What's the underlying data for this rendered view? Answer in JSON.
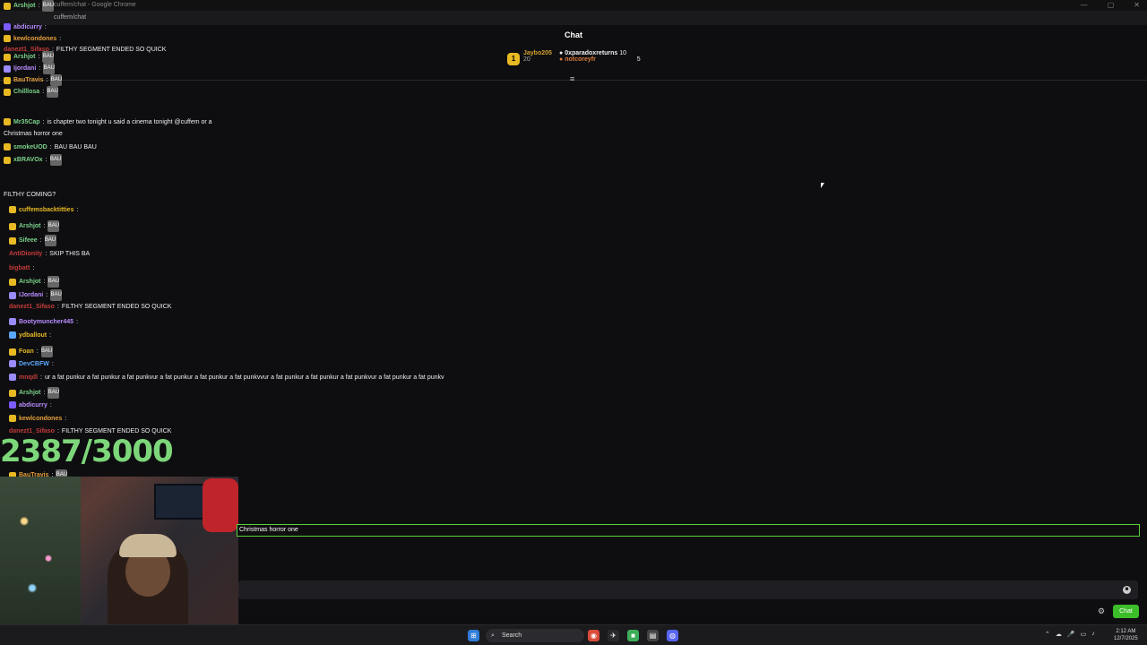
{
  "window": {
    "title": "cuffem/chat - Google Chrome",
    "url": "cuffem/chat"
  },
  "header": {
    "title": "Chat",
    "leaderboard": [
      {
        "rank": "1",
        "name": "Jaybo205",
        "count": "20",
        "color": "#d4a12c"
      },
      {
        "rank": "",
        "name": "0xparadoxreturns",
        "count": "10",
        "color": "#ffffff"
      },
      {
        "rank": "",
        "name": "notcoreyfr",
        "count": "5",
        "color": "#d97b3a"
      }
    ]
  },
  "messages": [
    {
      "user": "Arshjot",
      "text": "",
      "emote": "BAU",
      "color": "#7bd389",
      "badge": "#e8b923"
    },
    {
      "user": "abdicurry",
      "text": "",
      "emote": "",
      "color": "#b98cff",
      "badge": "#7c5cff"
    },
    {
      "user": "kewlcondones",
      "text": "",
      "emote": "",
      "color": "#e59e3a",
      "badge": "#e8b923"
    },
    {
      "user": "danezt1_Sifaso",
      "text": "FILTHY SEGMENT ENDED SO QUICK",
      "emote": "",
      "color": "#c43b3b",
      "badge": ""
    },
    {
      "user": "Arshjot",
      "text": "",
      "emote": "BAU",
      "color": "#7bd389",
      "badge": "#e8b923"
    },
    {
      "user": "Ijordani",
      "text": "",
      "emote": "BAU",
      "color": "#b98cff",
      "badge": "#9b8cff"
    },
    {
      "user": "BauTravis",
      "text": "",
      "emote": "BAU",
      "color": "#e59e3a",
      "badge": "#e8b923"
    },
    {
      "user": "Chilllosa",
      "text": "",
      "emote": "BAU",
      "color": "#7bd389",
      "badge": "#e8b923"
    },
    {
      "user": "Mr35Cap",
      "text": "is chapter two tonight u said a cinema tonight @cuffem or a",
      "emote": "",
      "color": "#7bd389",
      "badge": "#e8b923"
    },
    {
      "user": "",
      "text": "Christmas horror one",
      "emote": "",
      "color": "#ffffff",
      "badge": ""
    },
    {
      "user": "smokeUOD",
      "text": "BAU BAU BAU",
      "emote": "",
      "color": "#7bd389",
      "badge": "#e8b923"
    },
    {
      "user": "xBRAVOx",
      "text": "",
      "emote": "BAU",
      "color": "#7bd389",
      "badge": "#e8b923"
    },
    {
      "user": "",
      "text": "FILTHY COMING?",
      "emote": "",
      "color": "#ffffff",
      "badge": ""
    },
    {
      "user": "cuffemsbacktitties",
      "text": "",
      "emote": "",
      "color": "#e8b923",
      "badge": "#e8b923"
    },
    {
      "user": "Arshjot",
      "text": "",
      "emote": "BAU",
      "color": "#7bd389",
      "badge": "#e8b923"
    },
    {
      "user": "Sifeee",
      "text": "",
      "emote": "BAU",
      "color": "#7bd389",
      "badge": "#e8b923"
    },
    {
      "user": "AntiDionity",
      "text": "SKIP THIS BA",
      "emote": "",
      "color": "#c43b3b",
      "badge": ""
    },
    {
      "user": "bigbatt",
      "text": "",
      "emote": "",
      "color": "#c43b3b",
      "badge": ""
    },
    {
      "user": "Arshjot",
      "text": "",
      "emote": "BAU",
      "color": "#7bd389",
      "badge": "#e8b923"
    },
    {
      "user": "IJordani",
      "text": "",
      "emote": "BAU",
      "color": "#b98cff",
      "badge": "#9b8cff"
    },
    {
      "user": "danezt1_Sifaso",
      "text": "FILTHY SEGMENT ENDED SO QUICK",
      "emote": "",
      "color": "#c43b3b",
      "badge": ""
    },
    {
      "user": "Bootymuncher445",
      "text": "",
      "emote": "",
      "color": "#b98cff",
      "badge": "#9b8cff"
    },
    {
      "user": "ydballout",
      "text": "",
      "emote": "",
      "color": "#e8b923",
      "badge": "#5aa8ff"
    },
    {
      "user": "Foan",
      "text": "",
      "emote": "BAU",
      "color": "#e8b923",
      "badge": "#e8b923"
    },
    {
      "user": "DevCBFW",
      "text": "",
      "emote": "",
      "color": "#5aa8ff",
      "badge": "#9b8cff"
    },
    {
      "user": "mnqdl",
      "text": "ur a fat punkur a fat punkur a fat punkvur a fat punkur a fat punkur a fat punkvvur a fat punkur a fat punkur a fat punkvur a fat punkur a fat punkv",
      "emote": "",
      "color": "#c43b3b",
      "badge": "#9b8cff"
    },
    {
      "user": "Arshjot",
      "text": "",
      "emote": "BAU",
      "color": "#7bd389",
      "badge": "#e8b923"
    },
    {
      "user": "abdicurry",
      "text": "",
      "emote": "",
      "color": "#b98cff",
      "badge": "#7c5cff"
    },
    {
      "user": "kewlcondones",
      "text": "",
      "emote": "",
      "color": "#e59e3a",
      "badge": "#e8b923"
    },
    {
      "user": "danezt1_Sifaso",
      "text": "FILTHY SEGMENT ENDED SO QUICK",
      "emote": "",
      "color": "#c43b3b",
      "badge": ""
    },
    {
      "user": "BauTravis",
      "text": "",
      "emote": "BAU",
      "color": "#e59e3a",
      "badge": "#e8b923"
    }
  ],
  "overlay": {
    "counter": "2387/3000",
    "counter_color": "#7dd77a"
  },
  "preview": {
    "text": "Christmas horror one"
  },
  "composer": {
    "placeholder": "",
    "send_label": "Chat",
    "accent": "#3cbe2a"
  },
  "taskbar": {
    "search_label": "Search",
    "time": "2:12 AM",
    "date": "12/7/2025"
  }
}
